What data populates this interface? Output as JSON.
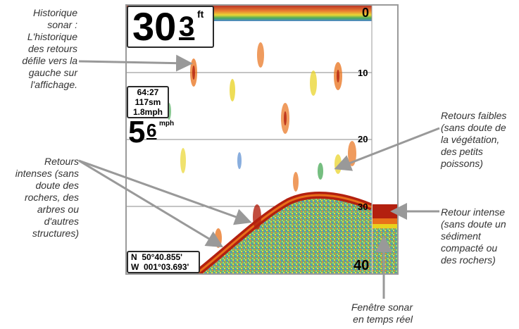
{
  "screen": {
    "depth": {
      "value": "30",
      "decimal": "3",
      "unit": "ft"
    },
    "info_box": {
      "line1": "64:27",
      "line2": "117sm",
      "line3": "1.8mph"
    },
    "speed": {
      "value": "5",
      "decimal": "6",
      "unit": "mph"
    },
    "scale_labels": [
      "0",
      "10",
      "20",
      "30",
      "40"
    ],
    "position": {
      "lat": "N  50°40.855'",
      "lon": "W  001°03.693'"
    }
  },
  "callouts": {
    "history": [
      "Historique",
      "sonar :",
      "L'historique",
      "des retours",
      "défile vers la",
      "gauche sur",
      "l'affichage."
    ],
    "strong_returns": [
      "Retours",
      "intenses (sans",
      "doute des",
      "rochers, des",
      "arbres ou",
      "d'autres",
      "structures)"
    ],
    "weak_returns": [
      "Retours faibles",
      "(sans doute de",
      "la végétation,",
      "des petits",
      "poissons)"
    ],
    "strong_return": [
      "Retour intense",
      "(sans doute un",
      "sédiment",
      "compacté ou",
      "des rochers)"
    ],
    "realtime_window": [
      "Fenêtre sonar",
      "en temps réel"
    ]
  },
  "colors": {
    "arrow": "#999999",
    "bottom_red": "#b3200f",
    "return_orange": "#e8701a",
    "return_yellow": "#e8d21e",
    "return_green": "#3aa34a",
    "return_blue": "#3a78c8"
  }
}
